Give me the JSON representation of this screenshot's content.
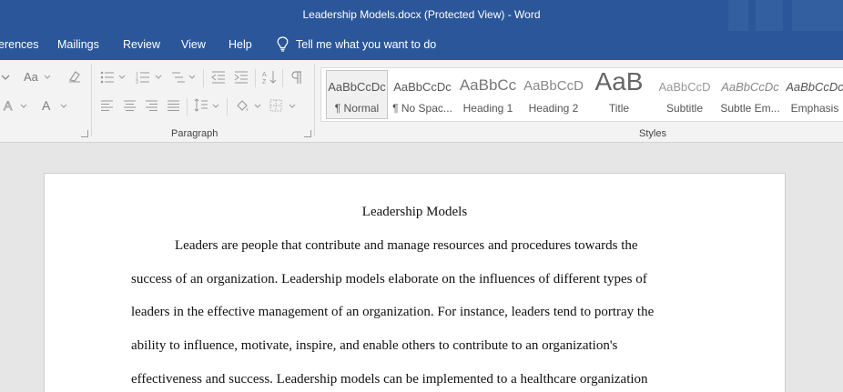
{
  "window": {
    "title": "Leadership Models.docx (Protected View)  -  Word"
  },
  "tabs": {
    "references": "erences",
    "mailings": "Mailings",
    "review": "Review",
    "view": "View",
    "help": "Help",
    "tell_me": "Tell me what you want to do"
  },
  "ribbon": {
    "paragraph_label": "Paragraph",
    "styles_label": "Styles",
    "font_size_button": "Aa",
    "font_color_button": "A",
    "styles": [
      {
        "sample": "AaBbCcDc",
        "label": "¶ Normal"
      },
      {
        "sample": "AaBbCcDc",
        "label": "¶ No Spac..."
      },
      {
        "sample": "AaBbCc",
        "label": "Heading 1"
      },
      {
        "sample": "AaBbCcD",
        "label": "Heading 2"
      },
      {
        "sample": "AaB",
        "label": "Title"
      },
      {
        "sample": "AaBbCcD",
        "label": "Subtitle"
      },
      {
        "sample": "AaBbCcDc",
        "label": "Subtle Em..."
      },
      {
        "sample": "AaBbCcDc",
        "label": "Emphasis"
      }
    ]
  },
  "document": {
    "title": "Leadership Models",
    "lines": [
      "Leaders are people that contribute and manage resources and procedures towards the",
      "success of an organization. Leadership models elaborate on the influences of different types of",
      "leaders in the effective management of an organization. For instance, leaders tend to portray the",
      "ability to influence, motivate, inspire, and enable others to contribute to an organization's",
      "effectiveness and success. Leadership models can be implemented to a healthcare organization"
    ]
  }
}
